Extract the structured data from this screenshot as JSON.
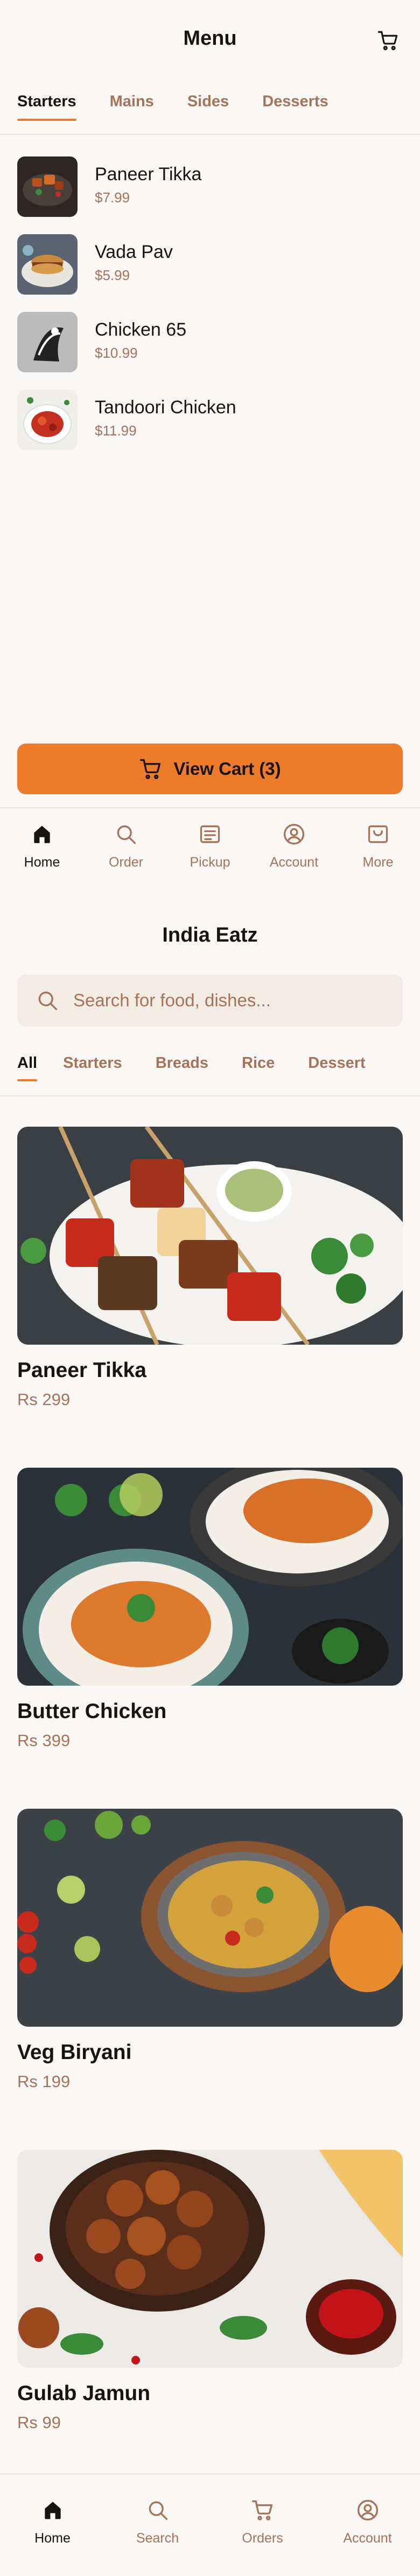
{
  "menu_header": {
    "title": "Menu"
  },
  "menu_tabs": [
    {
      "label": "Starters",
      "active": true
    },
    {
      "label": "Mains",
      "active": false
    },
    {
      "label": "Sides",
      "active": false
    },
    {
      "label": "Desserts",
      "active": false
    }
  ],
  "starters": [
    {
      "name": "Paneer Tikka",
      "price": "$7.99"
    },
    {
      "name": "Vada Pav",
      "price": "$5.99"
    },
    {
      "name": "Chicken 65",
      "price": "$10.99"
    },
    {
      "name": "Tandoori Chicken",
      "price": "$11.99"
    }
  ],
  "cart_button": {
    "label": "View Cart (3)"
  },
  "nav_primary": [
    {
      "label": "Home",
      "icon": "home-icon",
      "active": true
    },
    {
      "label": "Order",
      "icon": "search-icon",
      "active": false
    },
    {
      "label": "Pickup",
      "icon": "receipt-icon",
      "active": false
    },
    {
      "label": "Account",
      "icon": "user-icon",
      "active": false
    },
    {
      "label": "More",
      "icon": "box-icon",
      "active": false
    }
  ],
  "restaurant": {
    "title": "India Eatz",
    "search_placeholder": "Search for food, dishes..."
  },
  "restaurant_tabs": [
    {
      "label": "All",
      "active": true
    },
    {
      "label": "Starters",
      "active": false
    },
    {
      "label": "Breads",
      "active": false
    },
    {
      "label": "Rice",
      "active": false
    },
    {
      "label": "Dessert",
      "active": false
    }
  ],
  "dishes": [
    {
      "name": "Paneer Tikka",
      "price": "Rs 299"
    },
    {
      "name": "Butter Chicken",
      "price": "Rs 399"
    },
    {
      "name": "Veg Biryani",
      "price": "Rs 199"
    },
    {
      "name": "Gulab Jamun",
      "price": "Rs 99"
    }
  ],
  "nav_secondary": [
    {
      "label": "Home",
      "icon": "home-icon",
      "active": true
    },
    {
      "label": "Search",
      "icon": "search-icon",
      "active": false
    },
    {
      "label": "Orders",
      "icon": "cart-icon",
      "active": false
    },
    {
      "label": "Account",
      "icon": "user-icon",
      "active": false
    }
  ],
  "colors": {
    "accent": "#ec7b2c",
    "muted_text": "#a57358",
    "background": "#faf8f6",
    "search_bg": "#f2ece4"
  }
}
